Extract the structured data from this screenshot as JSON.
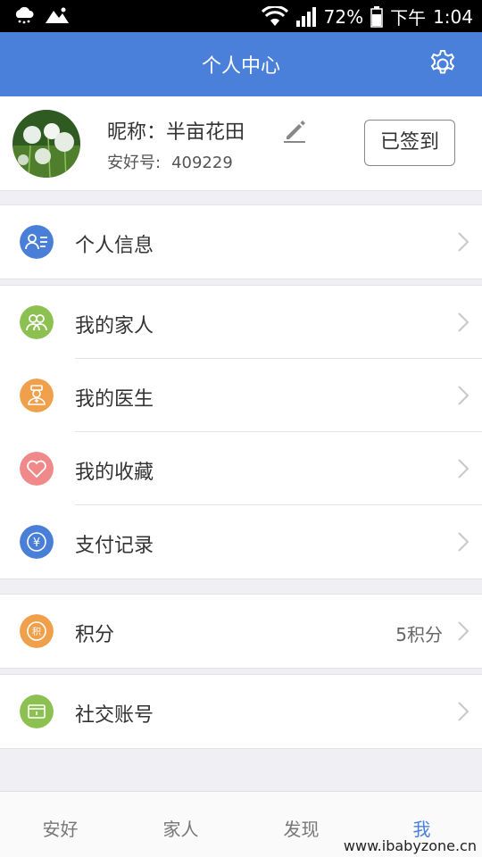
{
  "status": {
    "battery": "72%",
    "time_label": "下午",
    "time": "1:04"
  },
  "header": {
    "title": "个人中心",
    "settings_icon": "gear-icon"
  },
  "profile": {
    "nickname_label": "昵称：",
    "nickname": "半亩花田",
    "id_label": "安好号:",
    "id_value": "409229",
    "signin_label": "已签到"
  },
  "menu": {
    "personal_info": "个人信息",
    "family": "我的家人",
    "doctor": "我的医生",
    "favorites": "我的收藏",
    "payments": "支付记录",
    "points": "积分",
    "points_value": "5积分",
    "social": "社交账号"
  },
  "tabs": [
    "安好",
    "家人",
    "发现",
    "我"
  ],
  "watermark": "www.ibabyzone.cn",
  "colors": {
    "brand": "#4a80d9",
    "green": "#8cc152",
    "orange": "#f0a04b",
    "pink": "#f08a8a",
    "blue": "#4a7fd8"
  }
}
